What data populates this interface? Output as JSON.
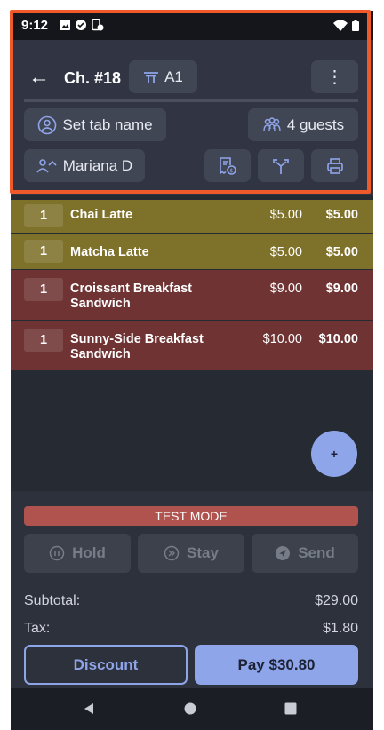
{
  "status_bar": {
    "time": "9:12"
  },
  "header": {
    "back_label": "←",
    "check_number": "Ch. #18",
    "table_label": "A1",
    "more_label": "⋮",
    "tab_name_label": "Set tab name",
    "guests_label": "4 guests",
    "server_name": "Mariana D"
  },
  "order_items": [
    {
      "qty": "1",
      "name": "Chai Latte",
      "price": "$5.00",
      "total": "$5.00",
      "color": "#7e7129"
    },
    {
      "qty": "1",
      "name": "Matcha Latte",
      "price": "$5.00",
      "total": "$5.00",
      "color": "#7e7129"
    },
    {
      "qty": "1",
      "name": "Croissant Breakfast Sandwich",
      "name_line1": "Croissant Breakfast",
      "name_line2": "Sandwich",
      "price": "$9.00",
      "total": "$9.00",
      "color": "#6f3333"
    },
    {
      "qty": "1",
      "name": "Sunny-Side Breakfast Sandwich",
      "name_line1": "Sunny-Side Breakfast",
      "name_line2": "Sandwich",
      "price": "$10.00",
      "total": "$10.00",
      "color": "#6f3333"
    }
  ],
  "fab_label": "+",
  "footer": {
    "test_mode_label": "TEST MODE",
    "hold_label": "Hold",
    "stay_label": "Stay",
    "send_label": "Send",
    "subtotal_label": "Subtotal:",
    "subtotal_value": "$29.00",
    "tax_label": "Tax:",
    "tax_value": "$1.80",
    "discount_label": "Discount",
    "pay_label": "Pay $30.80"
  },
  "colors": {
    "header_bg": "#313543",
    "accent": "#8fa5ea",
    "highlight_border": "#f05a2a",
    "test_mode": "#b0534f"
  }
}
